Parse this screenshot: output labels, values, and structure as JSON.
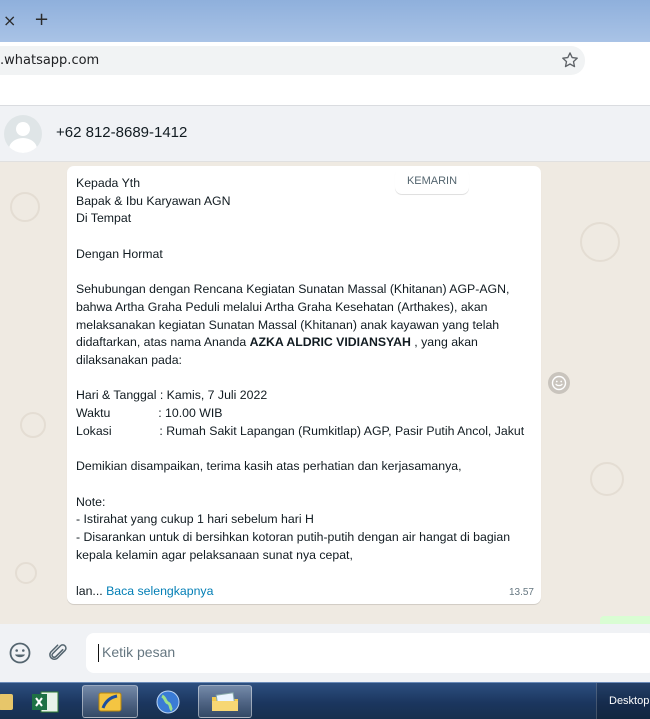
{
  "browser": {
    "tab_close": "×",
    "tab_new": "+",
    "url": ".whatsapp.com"
  },
  "chat": {
    "contact_name": "+62 812-8689-1412",
    "date_divider": "KEMARIN",
    "message": {
      "line_block_1": "Kepada Yth\nBapak & Ibu Karyawan AGN\nDi Tempat\n\nDengan Hormat\n\nSehubungan dengan Rencana Kegiatan Sunatan Massal (Khitanan) AGP-AGN, bahwa Artha Graha Peduli melalui Artha Graha Kesehatan (Arthakes), akan melaksanakan kegiatan Sunatan Massal (Khitanan) anak kayawan yang telah didaftarkan, atas nama Ananda ",
      "bold_name": "AZKA ALDRIC VIDIANSYAH",
      "line_block_2": " , yang akan dilaksanakan pada:\n\nHari & Tanggal : Kamis, 7 Juli 2022\nWaktu              : 10.00 WIB\nLokasi              : Rumah Sakit Lapangan (Rumkitlap) AGP, Pasir Putih Ancol, Jakut\n\nDemikian disampaikan, terima kasih atas perhatian dan kerjasamanya,\n\nNote:\n- Istirahat yang cukup 1 hari sebelum hari H\n- Disarankan untuk di bersihkan kotoran putih-putih dengan air hangat di bagian kepala kelamin agar pelaksanaan sunat nya cepat,",
      "truncated_prefix": "lan... ",
      "read_more": "Baca selengkapnya",
      "time": "13.57"
    }
  },
  "composer": {
    "placeholder": "Ketik pesan"
  },
  "taskbar": {
    "desktop_label": "Desktop"
  },
  "colors": {
    "chat_bg": "#efeae2",
    "bubble": "#ffffff",
    "link": "#027eb5",
    "taskbar": "#1b365f"
  }
}
